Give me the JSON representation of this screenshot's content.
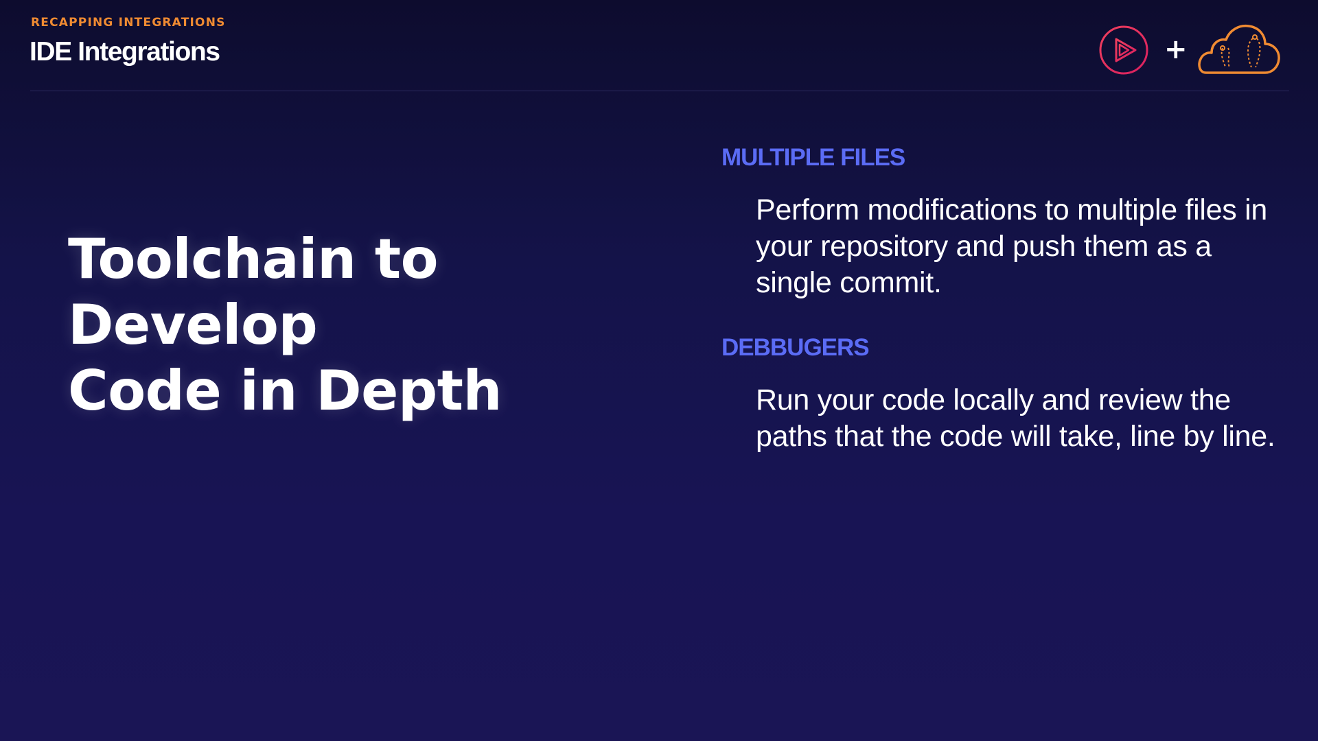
{
  "header": {
    "kicker": "RECAPPING INTEGRATIONS",
    "title": "IDE Integrations",
    "logos": {
      "left_icon": "play-triangle-icon",
      "plus": "+",
      "right_icon": "cloud-icon"
    }
  },
  "hero": {
    "line1": "Toolchain to Develop",
    "line2": "Code in Depth"
  },
  "sections": [
    {
      "heading": "MULTIPLE FILES",
      "body": "Perform modifications to multiple files in your repository and push them as a single commit."
    },
    {
      "heading": "DEBBUGERS",
      "body": "Run your code locally and review the paths that the code will take, line by line."
    }
  ],
  "colors": {
    "kicker": "#f08b32",
    "heading": "#5b6cf5",
    "text": "#ffffff",
    "background_top": "#0d0c2e",
    "background_bottom": "#1a1555",
    "play_logo_ring": "#e8305a",
    "cloud_logo": "#f08b32"
  }
}
